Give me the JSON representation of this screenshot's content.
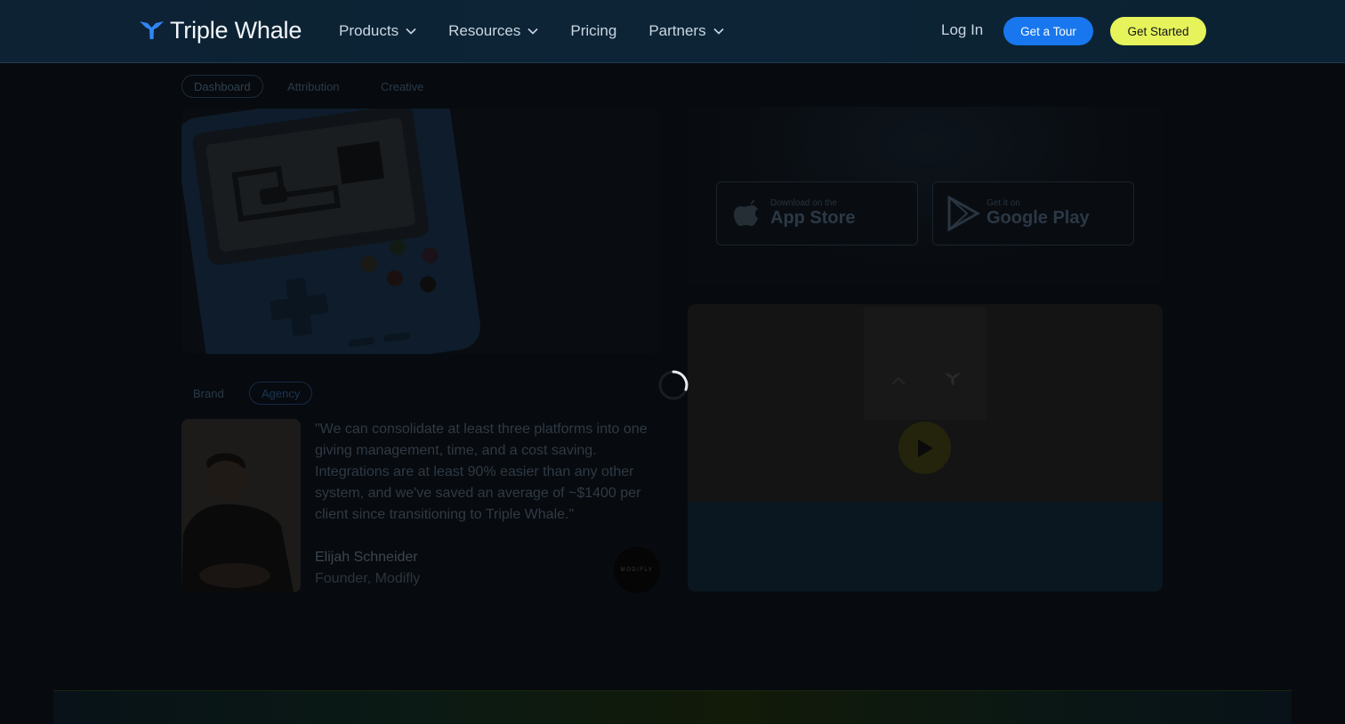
{
  "header": {
    "brand": "Triple Whale",
    "nav": [
      {
        "label": "Products",
        "has_dropdown": true
      },
      {
        "label": "Resources",
        "has_dropdown": true
      },
      {
        "label": "Pricing",
        "has_dropdown": false
      },
      {
        "label": "Partners",
        "has_dropdown": true
      }
    ],
    "login": "Log In",
    "tour_button": "Get a Tour",
    "start_button": "Get Started"
  },
  "content": {
    "tabs": [
      "Dashboard",
      "Attribution",
      "Creative"
    ],
    "active_tab": "Dashboard",
    "store_buttons": {
      "apple": {
        "small": "Download on the",
        "big": "App Store"
      },
      "google": {
        "small": "Get it on",
        "big": "Google Play"
      }
    },
    "testimonial_tabs": [
      "Brand",
      "Agency"
    ],
    "active_testimonial_tab": "Agency",
    "quote": "\"We can consolidate at least three platforms into one giving management, time, and a cost saving. Integrations are at least 90% easier than any other system, and we've saved an average of ~$1400 per client since transitioning to Triple Whale.\"",
    "author": "Elijah Schneider",
    "role": "Founder, Modifly",
    "brand_logo": "MODIFLY"
  },
  "colors": {
    "accent_blue": "#1877ee",
    "accent_yellow": "#e6f35a",
    "header_bg": "#0c2436"
  },
  "overlay": {
    "loading": true,
    "icon": "spinner-icon"
  }
}
